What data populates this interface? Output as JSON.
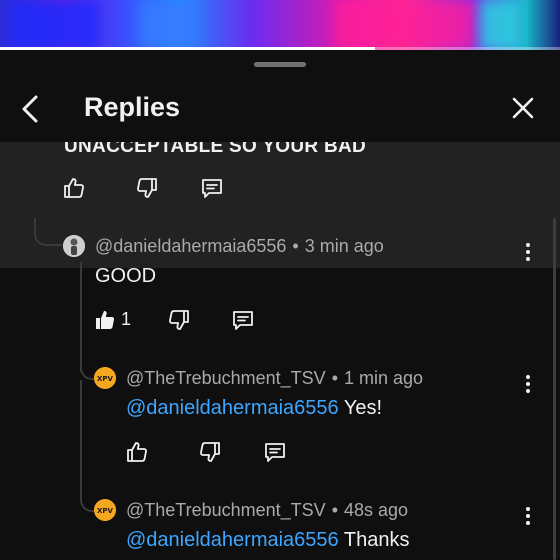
{
  "header": {
    "title": "Replies"
  },
  "video": {
    "progress": 0.67
  },
  "parent_comment": {
    "text": "UNACCEPTABLE SO YOUR BAD"
  },
  "comments": [
    {
      "username": "@danieldahermaia6556",
      "time": "3 min ago",
      "text": "GOOD",
      "like_count": "1"
    },
    {
      "username": "@TheTrebuchment_TSV",
      "time": "1 min ago",
      "mention": "@danieldahermaia6556",
      "text": "Yes!"
    },
    {
      "username": "@TheTrebuchment_TSV",
      "time": "48s ago",
      "mention": "@danieldahermaia6556",
      "text": "Thanks"
    }
  ],
  "colors": {
    "background": "#0f0f0f",
    "highlight": "#222222",
    "mention": "#3ea6ff",
    "meta": "#aaaaaa",
    "avatar_tsv": "#f4a81d"
  },
  "icons": [
    "chevron-left-icon",
    "close-icon",
    "thumbs-up-icon",
    "thumbs-down-icon",
    "comment-icon",
    "more-vert-icon"
  ]
}
